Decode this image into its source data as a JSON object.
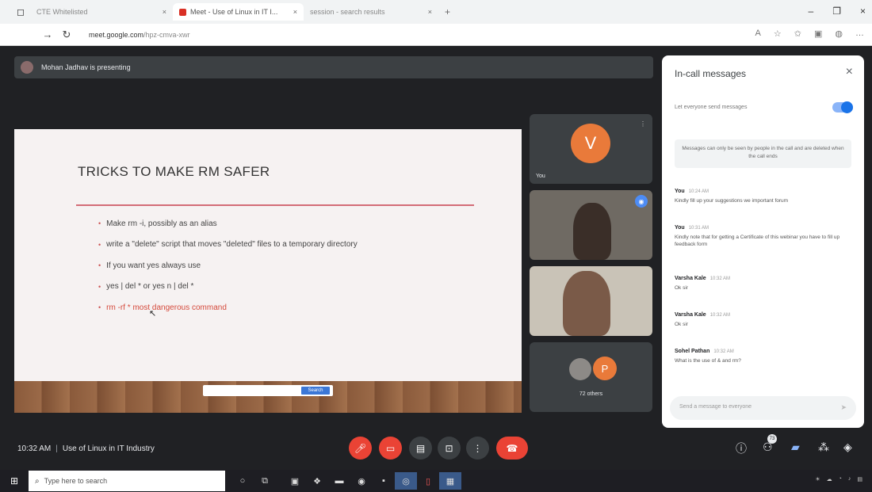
{
  "browser": {
    "tabs": [
      {
        "label": "CTE Whitelisted",
        "active": false
      },
      {
        "label": "Meet - Use of Linux in IT I...",
        "active": true
      },
      {
        "label": "session - search results",
        "active": false
      }
    ],
    "url_domain": "meet.google.com",
    "url_path": "/hpz-cmva-xwr"
  },
  "presenter": {
    "text": "Mohan Jadhav is presenting"
  },
  "slide": {
    "title": "TRICKS TO MAKE RM SAFER",
    "bullets": [
      "Make rm -i, possibly as an alias",
      "write a \"delete\" script that moves \"deleted\" files to a temporary directory",
      "If you want yes always use",
      "yes | del * or yes n | del *",
      "rm -rf * most dangerous command"
    ],
    "search_button": "Search"
  },
  "tiles": {
    "self": {
      "initial": "V",
      "name": "You"
    },
    "others_initial": "P",
    "others_count": "72 others"
  },
  "chat": {
    "title": "In-call messages",
    "permission": "Let everyone send messages",
    "note": "Messages can only be seen by people in the call and are deleted when the call ends",
    "messages": [
      {
        "sender": "You",
        "time": "10:24 AM",
        "text": "Kindly fill up your suggestions we important forum"
      },
      {
        "sender": "You",
        "time": "10:31 AM",
        "text": "Kindly note that for getting a Certificate of this webinar you have to fill up feedback form"
      },
      {
        "sender": "Varsha Kale",
        "time": "10:32 AM",
        "text": "Ok sir"
      },
      {
        "sender": "Varsha Kale",
        "time": "10:32 AM",
        "text": "Ok sir"
      },
      {
        "sender": "Sohel Pathan",
        "time": "10:32 AM",
        "text": "What is the use of & and rm?"
      }
    ],
    "input_placeholder": "Send a message to everyone"
  },
  "meeting": {
    "time": "10:32 AM",
    "title": "Use of Linux in IT Industry",
    "participants_badge": "73"
  },
  "taskbar": {
    "search_placeholder": "Type here to search"
  },
  "colors": {
    "meet_bg": "#202124",
    "accent_red": "#ea4335",
    "avatar_orange": "#e97a3a",
    "chat_accent": "#1a73e8"
  }
}
